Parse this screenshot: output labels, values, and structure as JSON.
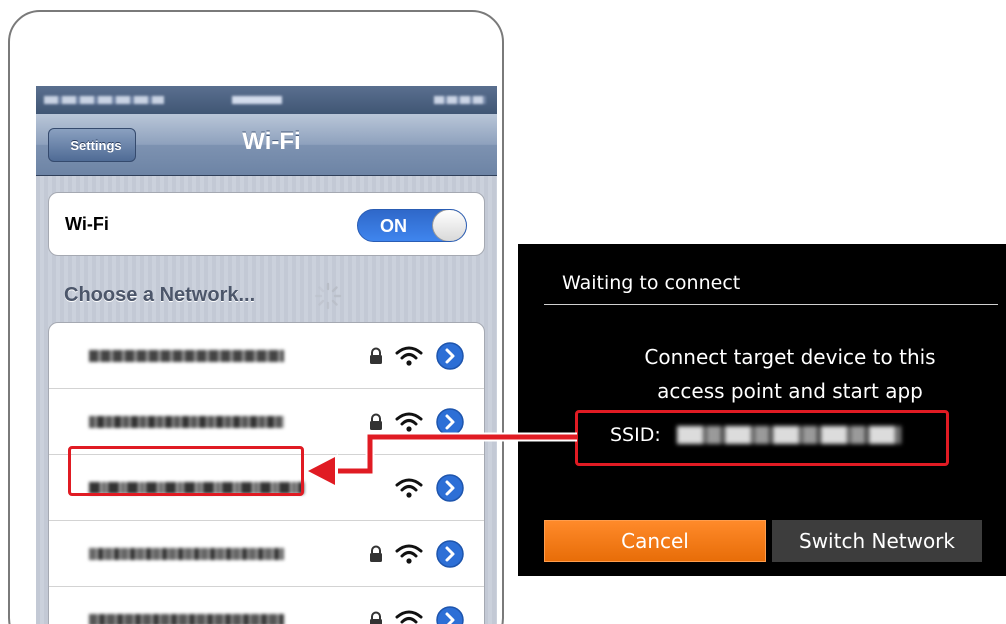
{
  "phone": {
    "nav": {
      "back_label": "Settings",
      "title": "Wi-Fi"
    },
    "wifi_toggle": {
      "label": "Wi-Fi",
      "state": "ON"
    },
    "choose_network_label": "Choose a Network...",
    "networks": [
      {
        "locked": true,
        "highlighted": false
      },
      {
        "locked": true,
        "highlighted": false
      },
      {
        "locked": false,
        "highlighted": true
      },
      {
        "locked": true,
        "highlighted": false
      },
      {
        "locked": true,
        "highlighted": false
      }
    ]
  },
  "camera_dialog": {
    "title": "Waiting to connect",
    "message_line1": "Connect target device to this",
    "message_line2": "access point and start app",
    "ssid_label": "SSID:",
    "cancel_label": "Cancel",
    "switch_label": "Switch Network"
  },
  "colors": {
    "highlight": "#e01b23",
    "toggle_on": "#3a7ee6",
    "cancel_button": "#f47b17",
    "detail_disclosure": "#2d6fd6"
  }
}
